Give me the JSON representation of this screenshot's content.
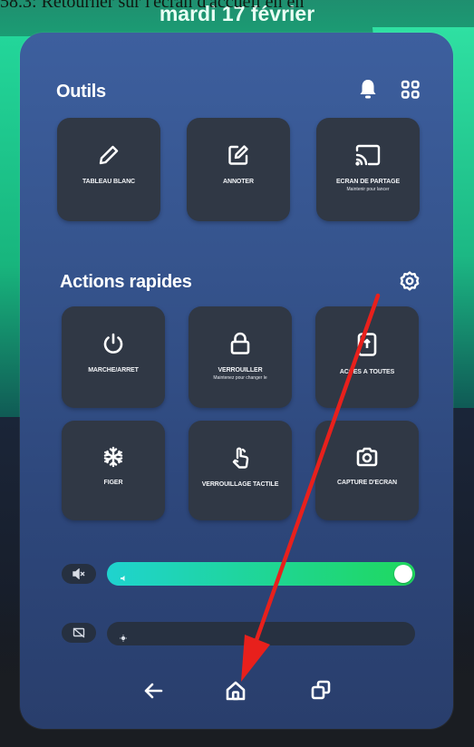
{
  "caption": "58.3: Retourner sur l'écran d'accueil en en",
  "date": "mardi 17 février",
  "tools": {
    "title": "Outils",
    "tiles": [
      {
        "label": "TABLEAU BLANC",
        "sub": ""
      },
      {
        "label": "ANNOTER",
        "sub": ""
      },
      {
        "label": "ÉCRAN DE PARTAGE",
        "sub": "Maintenir pour lancer"
      }
    ]
  },
  "quick": {
    "title": "Actions rapides",
    "tiles": [
      {
        "label": "MARCHE/ARRÊT",
        "sub": ""
      },
      {
        "label": "VERROUILLER",
        "sub": "Maintenez pour changer le"
      },
      {
        "label": "ACCÈS À TOUTES",
        "sub": ""
      },
      {
        "label": "FIGER",
        "sub": ""
      },
      {
        "label": "VERROUILLAGE TACTILE",
        "sub": ""
      },
      {
        "label": "CAPTURE D'ÉCRAN",
        "sub": ""
      }
    ]
  },
  "sliders": {
    "volume_level": 1.0,
    "brightness_level": 0.0
  },
  "colors": {
    "panel": "#35538c",
    "tile": "#303845",
    "volume_track_start": "#1fd3cf",
    "volume_track_end": "#1fd85e",
    "arrow": "#e8201c"
  },
  "icons": {
    "bell": "bell-icon",
    "grid": "apps-grid-icon",
    "gear": "gear-icon",
    "back": "back-arrow-icon",
    "home": "home-icon",
    "recents": "recents-icon"
  }
}
